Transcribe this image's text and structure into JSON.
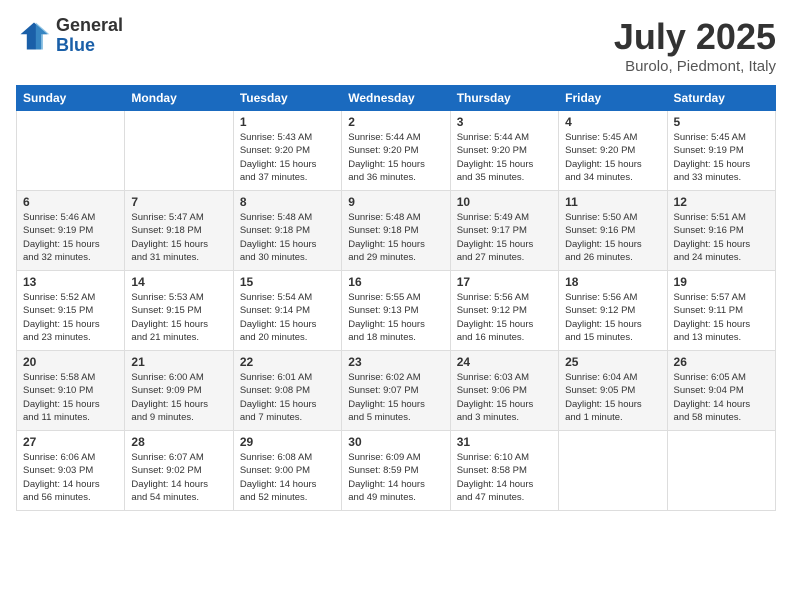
{
  "header": {
    "logo_general": "General",
    "logo_blue": "Blue",
    "month_title": "July 2025",
    "location": "Burolo, Piedmont, Italy"
  },
  "weekdays": [
    "Sunday",
    "Monday",
    "Tuesday",
    "Wednesday",
    "Thursday",
    "Friday",
    "Saturday"
  ],
  "weeks": [
    [
      {
        "day": "",
        "info": ""
      },
      {
        "day": "",
        "info": ""
      },
      {
        "day": "1",
        "info": "Sunrise: 5:43 AM\nSunset: 9:20 PM\nDaylight: 15 hours\nand 37 minutes."
      },
      {
        "day": "2",
        "info": "Sunrise: 5:44 AM\nSunset: 9:20 PM\nDaylight: 15 hours\nand 36 minutes."
      },
      {
        "day": "3",
        "info": "Sunrise: 5:44 AM\nSunset: 9:20 PM\nDaylight: 15 hours\nand 35 minutes."
      },
      {
        "day": "4",
        "info": "Sunrise: 5:45 AM\nSunset: 9:20 PM\nDaylight: 15 hours\nand 34 minutes."
      },
      {
        "day": "5",
        "info": "Sunrise: 5:45 AM\nSunset: 9:19 PM\nDaylight: 15 hours\nand 33 minutes."
      }
    ],
    [
      {
        "day": "6",
        "info": "Sunrise: 5:46 AM\nSunset: 9:19 PM\nDaylight: 15 hours\nand 32 minutes."
      },
      {
        "day": "7",
        "info": "Sunrise: 5:47 AM\nSunset: 9:18 PM\nDaylight: 15 hours\nand 31 minutes."
      },
      {
        "day": "8",
        "info": "Sunrise: 5:48 AM\nSunset: 9:18 PM\nDaylight: 15 hours\nand 30 minutes."
      },
      {
        "day": "9",
        "info": "Sunrise: 5:48 AM\nSunset: 9:18 PM\nDaylight: 15 hours\nand 29 minutes."
      },
      {
        "day": "10",
        "info": "Sunrise: 5:49 AM\nSunset: 9:17 PM\nDaylight: 15 hours\nand 27 minutes."
      },
      {
        "day": "11",
        "info": "Sunrise: 5:50 AM\nSunset: 9:16 PM\nDaylight: 15 hours\nand 26 minutes."
      },
      {
        "day": "12",
        "info": "Sunrise: 5:51 AM\nSunset: 9:16 PM\nDaylight: 15 hours\nand 24 minutes."
      }
    ],
    [
      {
        "day": "13",
        "info": "Sunrise: 5:52 AM\nSunset: 9:15 PM\nDaylight: 15 hours\nand 23 minutes."
      },
      {
        "day": "14",
        "info": "Sunrise: 5:53 AM\nSunset: 9:15 PM\nDaylight: 15 hours\nand 21 minutes."
      },
      {
        "day": "15",
        "info": "Sunrise: 5:54 AM\nSunset: 9:14 PM\nDaylight: 15 hours\nand 20 minutes."
      },
      {
        "day": "16",
        "info": "Sunrise: 5:55 AM\nSunset: 9:13 PM\nDaylight: 15 hours\nand 18 minutes."
      },
      {
        "day": "17",
        "info": "Sunrise: 5:56 AM\nSunset: 9:12 PM\nDaylight: 15 hours\nand 16 minutes."
      },
      {
        "day": "18",
        "info": "Sunrise: 5:56 AM\nSunset: 9:12 PM\nDaylight: 15 hours\nand 15 minutes."
      },
      {
        "day": "19",
        "info": "Sunrise: 5:57 AM\nSunset: 9:11 PM\nDaylight: 15 hours\nand 13 minutes."
      }
    ],
    [
      {
        "day": "20",
        "info": "Sunrise: 5:58 AM\nSunset: 9:10 PM\nDaylight: 15 hours\nand 11 minutes."
      },
      {
        "day": "21",
        "info": "Sunrise: 6:00 AM\nSunset: 9:09 PM\nDaylight: 15 hours\nand 9 minutes."
      },
      {
        "day": "22",
        "info": "Sunrise: 6:01 AM\nSunset: 9:08 PM\nDaylight: 15 hours\nand 7 minutes."
      },
      {
        "day": "23",
        "info": "Sunrise: 6:02 AM\nSunset: 9:07 PM\nDaylight: 15 hours\nand 5 minutes."
      },
      {
        "day": "24",
        "info": "Sunrise: 6:03 AM\nSunset: 9:06 PM\nDaylight: 15 hours\nand 3 minutes."
      },
      {
        "day": "25",
        "info": "Sunrise: 6:04 AM\nSunset: 9:05 PM\nDaylight: 15 hours\nand 1 minute."
      },
      {
        "day": "26",
        "info": "Sunrise: 6:05 AM\nSunset: 9:04 PM\nDaylight: 14 hours\nand 58 minutes."
      }
    ],
    [
      {
        "day": "27",
        "info": "Sunrise: 6:06 AM\nSunset: 9:03 PM\nDaylight: 14 hours\nand 56 minutes."
      },
      {
        "day": "28",
        "info": "Sunrise: 6:07 AM\nSunset: 9:02 PM\nDaylight: 14 hours\nand 54 minutes."
      },
      {
        "day": "29",
        "info": "Sunrise: 6:08 AM\nSunset: 9:00 PM\nDaylight: 14 hours\nand 52 minutes."
      },
      {
        "day": "30",
        "info": "Sunrise: 6:09 AM\nSunset: 8:59 PM\nDaylight: 14 hours\nand 49 minutes."
      },
      {
        "day": "31",
        "info": "Sunrise: 6:10 AM\nSunset: 8:58 PM\nDaylight: 14 hours\nand 47 minutes."
      },
      {
        "day": "",
        "info": ""
      },
      {
        "day": "",
        "info": ""
      }
    ]
  ]
}
